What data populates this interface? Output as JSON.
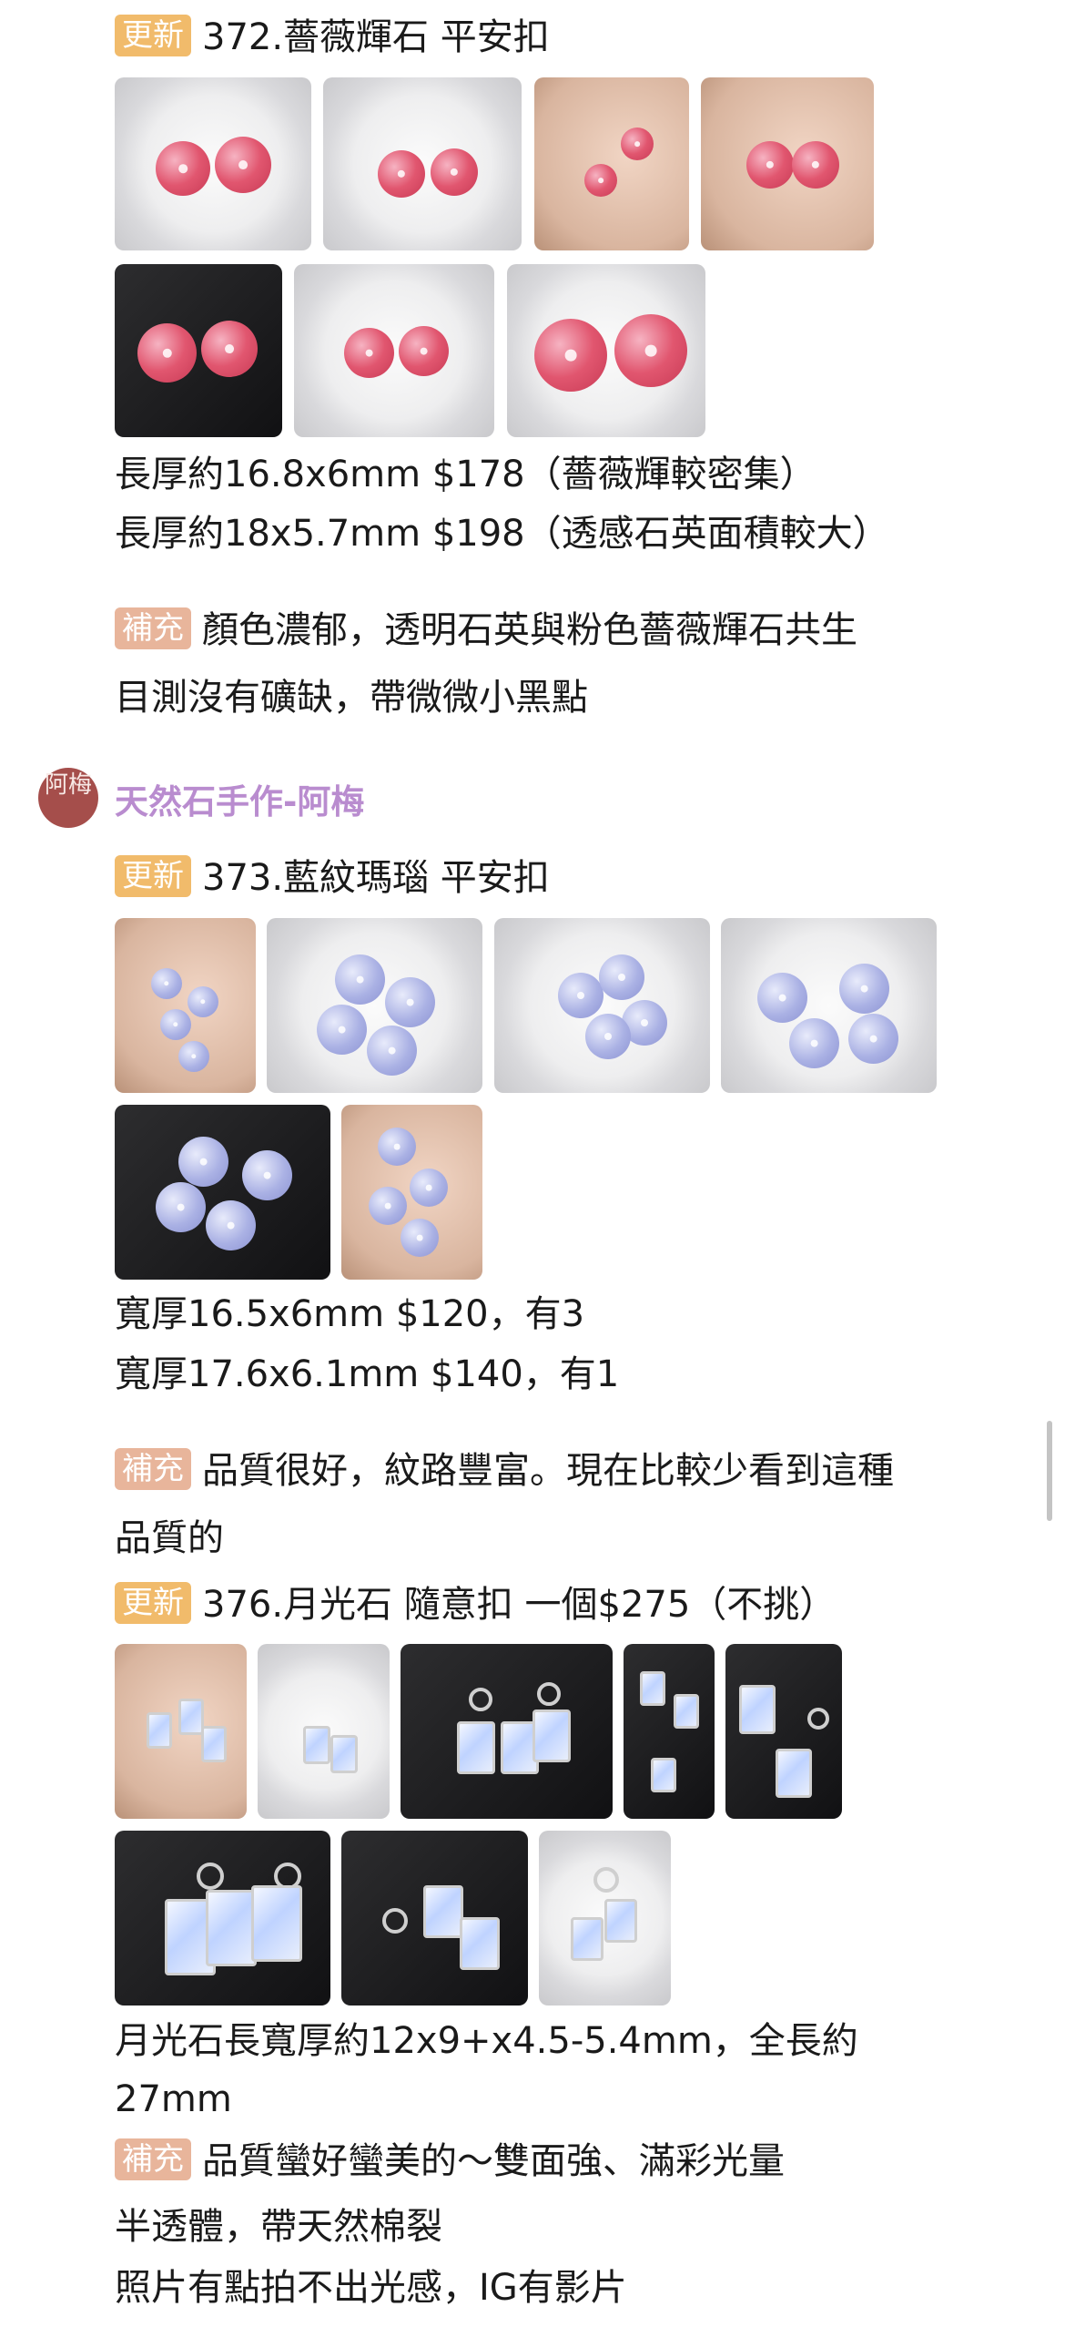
{
  "posts": [
    {
      "badge": "更新",
      "title": "372.薔薇輝石 平安扣",
      "lines": [
        "長厚約16.8x6mm $178（薔薇輝較密集）",
        "長厚約18x5.7mm $198（透感石英面積較大）"
      ],
      "supp_badge": "補充",
      "supp": [
        "顏色濃郁，透明石英與粉色薔薇輝石共生",
        "目測沒有礦缺，帶微微小黑點"
      ]
    },
    {
      "author": "天然石手作-阿梅",
      "avatar_text": "阿梅",
      "badge": "更新",
      "title": "373.藍紋瑪瑙 平安扣",
      "lines": [
        "寬厚16.5x6mm $120，有3",
        "寬厚17.6x6.1mm $140，有1"
      ],
      "supp_badge": "補充",
      "supp": [
        "品質很好，紋路豐富。現在比較少看到這種",
        "品質的"
      ]
    },
    {
      "badge": "更新",
      "title": "376.月光石 隨意扣 一個$275（不挑）",
      "lines": [
        "月光石長寬厚約12x9+x4.5-5.4mm，全長約",
        "27mm"
      ],
      "supp_badge": "補充",
      "supp": [
        "品質蠻好蠻美的～雙面強、滿彩光量",
        "半透體，帶天然棉裂",
        "照片有點拍不出光感，IG有影片"
      ]
    }
  ]
}
